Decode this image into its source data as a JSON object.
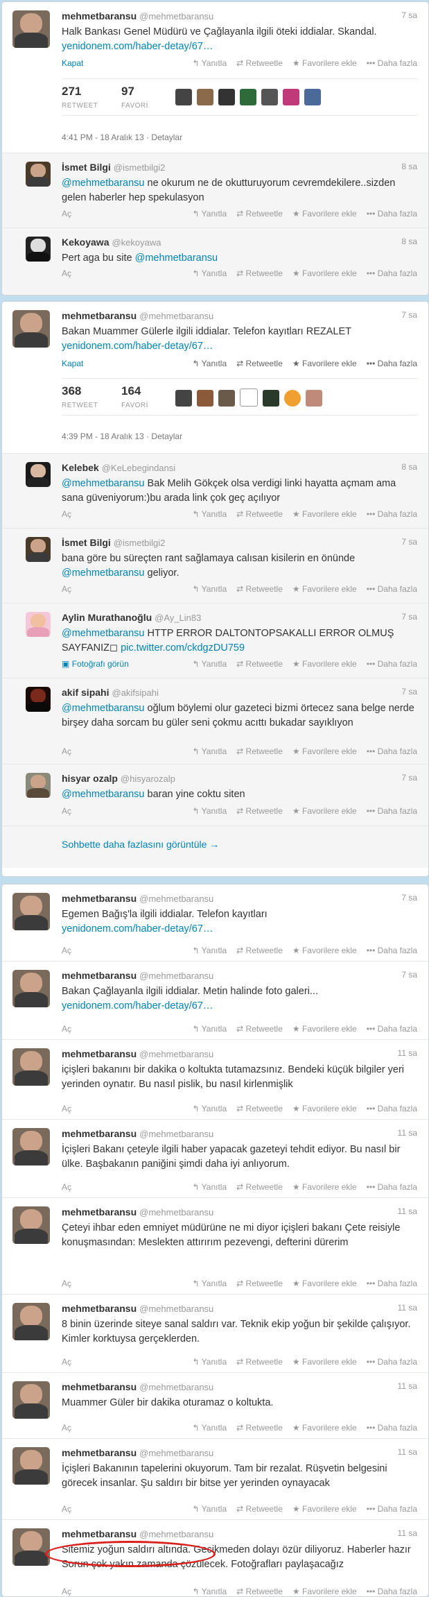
{
  "actions": {
    "reply": "↰ Yanıtla",
    "retweet": "⇄ Retweetle",
    "fav": "★ Favorilere ekle",
    "more": "••• Daha fazla",
    "open": "Aç",
    "close": "Kapat"
  },
  "block1": {
    "main": {
      "name": "mehmetbaransu",
      "handle": "@mehmetbaransu",
      "time": "7 sa",
      "text": "Halk Bankası Genel Müdürü ve Çağlayanla ilgili öteki iddialar. Skandal.",
      "link": "yenidonem.com/haber-detay/67…",
      "retweets": "271",
      "retweet_label": "RETWEET",
      "favs": "97",
      "fav_label": "FAVORİ",
      "date": "4:41 PM - 18 Aralık 13",
      "details": "Detaylar"
    },
    "replies": [
      {
        "name": "İsmet Bilgi",
        "handle": "@ismetbilgi2",
        "time": "8 sa",
        "mention": "@mehmetbaransu",
        "text": " ne okurum ne de okutturuyorum cevremdekilere..sizden gelen haberler hep spekulasyon"
      },
      {
        "name": "Kekoyawa",
        "handle": "@kekoyawa",
        "time": "8 sa",
        "pre": "Pert aga bu site ",
        "mention": "@mehmetbaransu",
        "text": ""
      }
    ]
  },
  "block2": {
    "main": {
      "name": "mehmetbaransu",
      "handle": "@mehmetbaransu",
      "time": "7 sa",
      "text": "Bakan Muammer Gülerle ilgili iddialar. Telefon kayıtları REZALET",
      "link": "yenidonem.com/haber-detay/67…",
      "retweets": "368",
      "retweet_label": "RETWEET",
      "favs": "164",
      "fav_label": "FAVORİ",
      "date": "4:39 PM - 18 Aralık 13",
      "details": "Detaylar"
    },
    "replies": [
      {
        "name": "Kelebek",
        "handle": "@KeLebegindansi",
        "time": "8 sa",
        "mention": "@mehmetbaransu",
        "text": " Bak Melih Gökçek olsa verdigi linki hayatta açmam ama sana güveniyorum:)bu arada link çok geç açılıyor"
      },
      {
        "name": "İsmet Bilgi",
        "handle": "@ismetbilgi2",
        "time": "7 sa",
        "pre": "bana göre bu süreçten rant sağlamaya calısan kisilerin en önünde ",
        "mention": "@mehmetbaransu",
        "text": " geliyor."
      },
      {
        "name": "Aylin Murathanoğlu",
        "handle": "@Ay_Lin83",
        "time": "7 sa",
        "mention": "@mehmetbaransu",
        "text": " HTTP ERROR DALTONTOPSAKALLI ERROR OLMUŞ SAYFANIZ",
        "link": "pic.twitter.com/ckdgzDU759",
        "photo": "Fotoğrafı görün"
      },
      {
        "name": "akif sipahi",
        "handle": "@akifsipahi",
        "time": "7 sa",
        "mention": "@mehmetbaransu",
        "text": " oğlum böylemi olur gazeteci bizmi örtecez sana belge nerde birşey daha sorcam bu güler seni çokmu acıttı bukadar sayıklıyon"
      },
      {
        "name": "hisyar ozalp",
        "handle": "@hisyarozalp",
        "time": "7 sa",
        "mention": "@mehmetbaransu",
        "text": " baran yine coktu siten"
      }
    ],
    "more": "Sohbette daha fazlasını görüntüle →"
  },
  "block3": [
    {
      "name": "mehmetbaransu",
      "handle": "@mehmetbaransu",
      "time": "7 sa",
      "text": "Egemen Bağış'la ilgili iddialar. Telefon kayıtları",
      "link": "yenidonem.com/haber-detay/67…"
    },
    {
      "name": "mehmetbaransu",
      "handle": "@mehmetbaransu",
      "time": "7 sa",
      "text": "Bakan Çağlayanla ilgili iddialar. Metin halinde foto galeri...",
      "link": "yenidonem.com/haber-detay/67…"
    },
    {
      "name": "mehmetbaransu",
      "handle": "@mehmetbaransu",
      "time": "11 sa",
      "text": "içişleri bakanını bir dakika o koltukta tutamazsınız. Bendeki küçük bilgiler yeri yerinden oynatır. Bu nasıl pislik, bu nasıl kirlenmişlik"
    },
    {
      "name": "mehmetbaransu",
      "handle": "@mehmetbaransu",
      "time": "11 sa",
      "text": "İçişleri Bakanı çeteyle ilgili haber yapacak gazeteyi tehdit ediyor. Bu nasıl bir ülke. Başbakanın paniğini şimdi daha iyi anlıyorum."
    },
    {
      "name": "mehmetbaransu",
      "handle": "@mehmetbaransu",
      "time": "11 sa",
      "text": "Çeteyi ihbar eden emniyet müdürüne ne mi diyor içişleri bakanı Çete reisiyle konuşmasından: Meslekten attırırım pezevengi, defterini dürerim"
    },
    {
      "name": "mehmetbaransu",
      "handle": "@mehmetbaransu",
      "time": "11 sa",
      "text": "8 binin üzerinde siteye sanal saldırı var. Teknik ekip yoğun bir şekilde çalışıyor. Kimler korktuysa gerçeklerden."
    },
    {
      "name": "mehmetbaransu",
      "handle": "@mehmetbaransu",
      "time": "11 sa",
      "text": "Muammer Güler bir dakika oturamaz o koltukta."
    },
    {
      "name": "mehmetbaransu",
      "handle": "@mehmetbaransu",
      "time": "11 sa",
      "text": "İçişleri Bakanının tapelerini okuyorum. Tam bir rezalat. Rüşvetin belgesini görecek insanlar. Şu saldırı bir bitse yer yerinden oynayacak"
    },
    {
      "name": "mehmetbaransu",
      "handle": "@mehmetbaransu",
      "time": "11 sa",
      "text": "Sitemiz yoğun saldırı altında. Gecikmeden dolayı özür diliyoruz. Haberler hazır Sorun çok yakın zamanda çözülecek. Fotoğrafları paylaşacağız"
    }
  ]
}
